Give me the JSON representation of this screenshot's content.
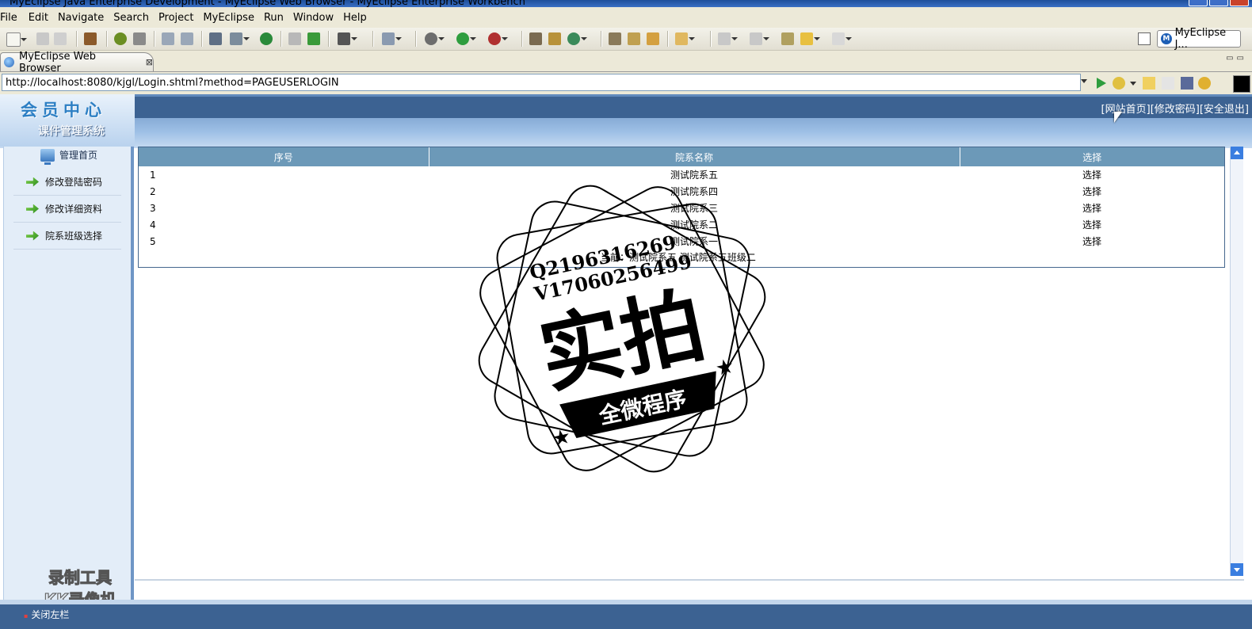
{
  "window": {
    "title": "MyEclipse Java Enterprise Development - MyEclipse Web Browser - MyEclipse Enterprise Workbench"
  },
  "menu": [
    "File",
    "Edit",
    "Navigate",
    "Search",
    "Project",
    "MyEclipse",
    "Run",
    "Window",
    "Help"
  ],
  "toolbar": {
    "perspective_label": "MyEclipse J..."
  },
  "editor_tab": {
    "label": "MyEclipse Web Browser"
  },
  "browser": {
    "url": "http://localhost:8080/kjgl/Login.shtml?method=PAGEUSERLOGIN"
  },
  "page": {
    "logo_title": "会员中心",
    "system_name": "课件管理系统",
    "top_links": [
      "[网站首页]",
      "[修改密码]",
      "[安全退出]"
    ],
    "home_link": "管理首页",
    "sidebar_items": [
      "修改登陆密码",
      "修改详细资料",
      "院系班级选择"
    ],
    "table": {
      "headers": [
        "序号",
        "院系名称",
        "选择"
      ],
      "rows": [
        {
          "no": "1",
          "name": "测试院系五",
          "action": "选择"
        },
        {
          "no": "2",
          "name": "测试院系四",
          "action": "选择"
        },
        {
          "no": "3",
          "name": "测试院系三",
          "action": "选择"
        },
        {
          "no": "4",
          "name": "测试院系二",
          "action": "选择"
        },
        {
          "no": "5",
          "name": "测试院系一",
          "action": "选择"
        }
      ],
      "current": "当前：测试院系五 测试院系五班级二"
    },
    "footer_close": "关闭左栏",
    "recorder_watermark": [
      "录制工具",
      "KK录像机"
    ]
  },
  "stamp": {
    "line1": "Q2196316269",
    "line2": "V17060256499",
    "main": "实拍",
    "banner": "全微程序"
  },
  "colors": {
    "header_dark": "#3c6292",
    "table_header": "#6c99b8",
    "sidebar_bg": "#e3edf8",
    "run_green": "#2e9d3e"
  }
}
